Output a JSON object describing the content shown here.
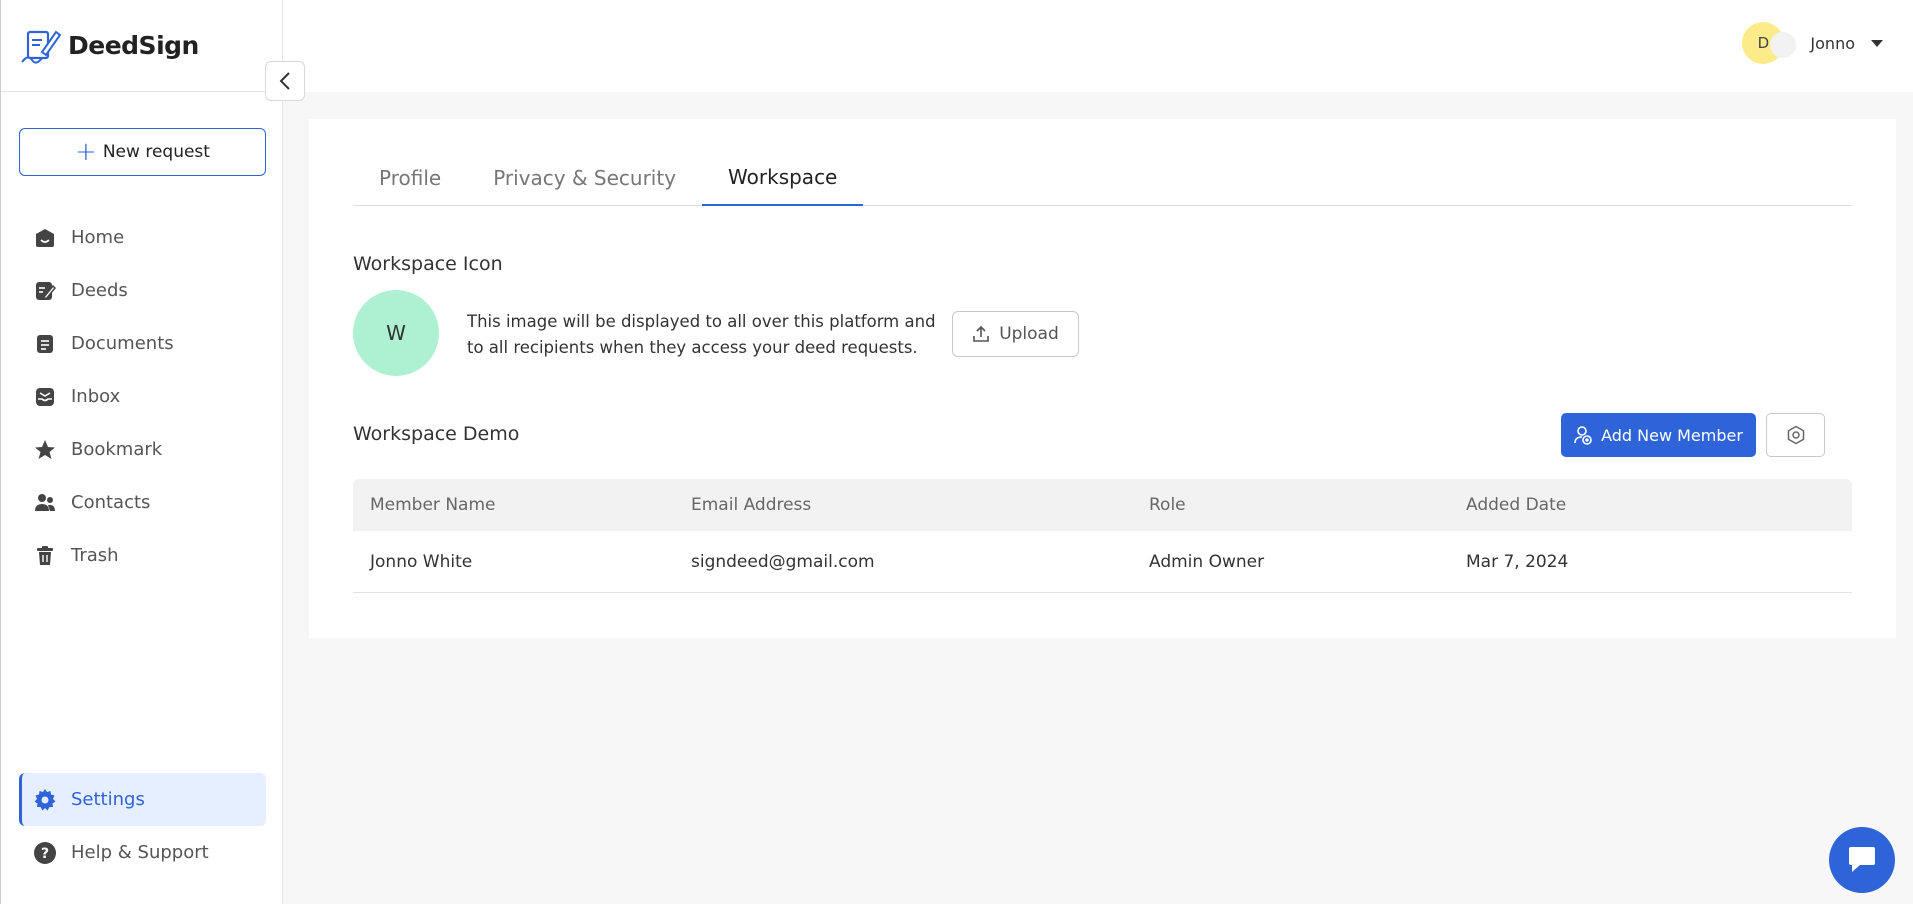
{
  "brand": {
    "name": "DeedSign"
  },
  "sidebar": {
    "new_request_label": "New request",
    "items": [
      {
        "label": "Home",
        "icon": "home-icon"
      },
      {
        "label": "Deeds",
        "icon": "deeds-icon"
      },
      {
        "label": "Documents",
        "icon": "documents-icon"
      },
      {
        "label": "Inbox",
        "icon": "inbox-icon"
      },
      {
        "label": "Bookmark",
        "icon": "star-icon"
      },
      {
        "label": "Contacts",
        "icon": "contacts-icon"
      },
      {
        "label": "Trash",
        "icon": "trash-icon"
      }
    ],
    "bottom_items": [
      {
        "label": "Settings",
        "icon": "gear-icon",
        "active": true
      },
      {
        "label": "Help & Support",
        "icon": "help-icon"
      }
    ]
  },
  "user": {
    "initial": "D",
    "name": "Jonno"
  },
  "tabs": [
    {
      "label": "Profile"
    },
    {
      "label": "Privacy & Security"
    },
    {
      "label": "Workspace",
      "active": true
    }
  ],
  "workspace": {
    "icon_title": "Workspace Icon",
    "icon_letter": "W",
    "icon_description": "This image will be displayed to all over this platform and to all recipients when they access your deed requests.",
    "upload_label": "Upload",
    "name": "Workspace Demo",
    "add_member_label": "Add New Member"
  },
  "members_table": {
    "columns": [
      "Member Name",
      "Email Address",
      "Role",
      "Added Date"
    ],
    "rows": [
      {
        "name": "Jonno White",
        "email": "signdeed@gmail.com",
        "role": "Admin Owner",
        "added": "Mar 7, 2024"
      }
    ]
  },
  "colors": {
    "accent": "#2e64d8",
    "workspace_icon_bg": "#aef1d2",
    "avatar_bg": "#fbeb8a"
  }
}
